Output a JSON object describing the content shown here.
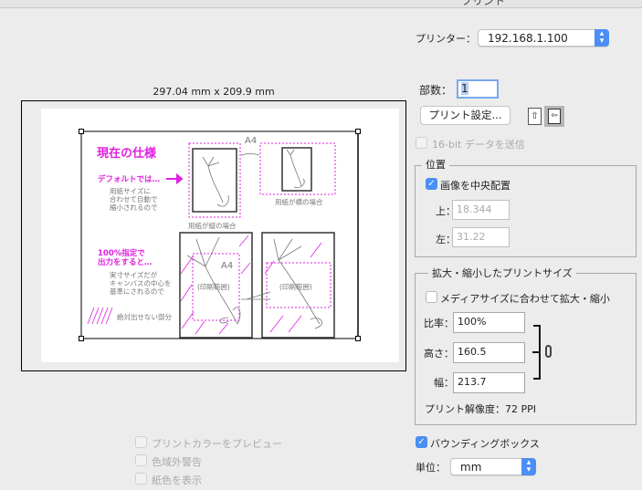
{
  "window": {
    "title": "プリント"
  },
  "preview": {
    "dimensions": "297.04 mm x 209.9 mm",
    "artwork": {
      "heading": "現在の仕様",
      "default_label": "デフォルトでは…",
      "default_note": [
        "用紙サイズに",
        "合わせて自動で",
        "縮小されるので"
      ],
      "portrait_caption": "用紙が縦の場合",
      "landscape_caption": "用紙が横の場合",
      "a4_top": "A4",
      "a4_bottom": "A4",
      "actual_label": [
        "100%指定で",
        "出力をすると…"
      ],
      "actual_note": [
        "実寸サイズだが",
        "キャンバスの中心を",
        "基準にされるので"
      ],
      "print_area_1": "(印刷範囲)",
      "print_area_2": "(印刷範囲)",
      "legend": "絶対出せない部分"
    },
    "options": [
      {
        "label": "プリントカラーをプレビュー",
        "checked": false,
        "enabled": false
      },
      {
        "label": "色域外警告",
        "checked": false,
        "enabled": false
      },
      {
        "label": "紙色を表示",
        "checked": false,
        "enabled": false
      }
    ]
  },
  "printer": {
    "label": "プリンター：",
    "value": "192.168.1.100"
  },
  "copies": {
    "label": "部数：",
    "value": "1"
  },
  "print_settings_button": "プリント設定...",
  "orientation": {
    "portrait_icon": "portrait-orientation-icon",
    "landscape_icon": "landscape-orientation-icon",
    "selected": "landscape"
  },
  "send_16bit": {
    "label": "16-bit データを送信",
    "checked": false,
    "enabled": false
  },
  "position": {
    "title": "位置",
    "center": {
      "label": "画像を中央配置",
      "checked": true
    },
    "top": {
      "label": "上：",
      "value": "18.344"
    },
    "left": {
      "label": "左：",
      "value": "31.22"
    }
  },
  "scaled_size": {
    "title": "拡大・縮小したプリントサイズ",
    "fit_media": {
      "label": "メディアサイズに合わせて拡大・縮小",
      "checked": false
    },
    "scale": {
      "label": "比率：",
      "value": "100%"
    },
    "height": {
      "label": "高さ：",
      "value": "160.5"
    },
    "width": {
      "label": "幅：",
      "value": "213.7"
    },
    "resolution": "プリント解像度：72 PPI"
  },
  "bounding_box": {
    "label": "バウンディングボックス",
    "checked": true
  },
  "units": {
    "label": "単位：",
    "value": "mm"
  },
  "colors": {
    "accent": "#4b8ef5",
    "artwork_magenta": "#e020e0"
  }
}
